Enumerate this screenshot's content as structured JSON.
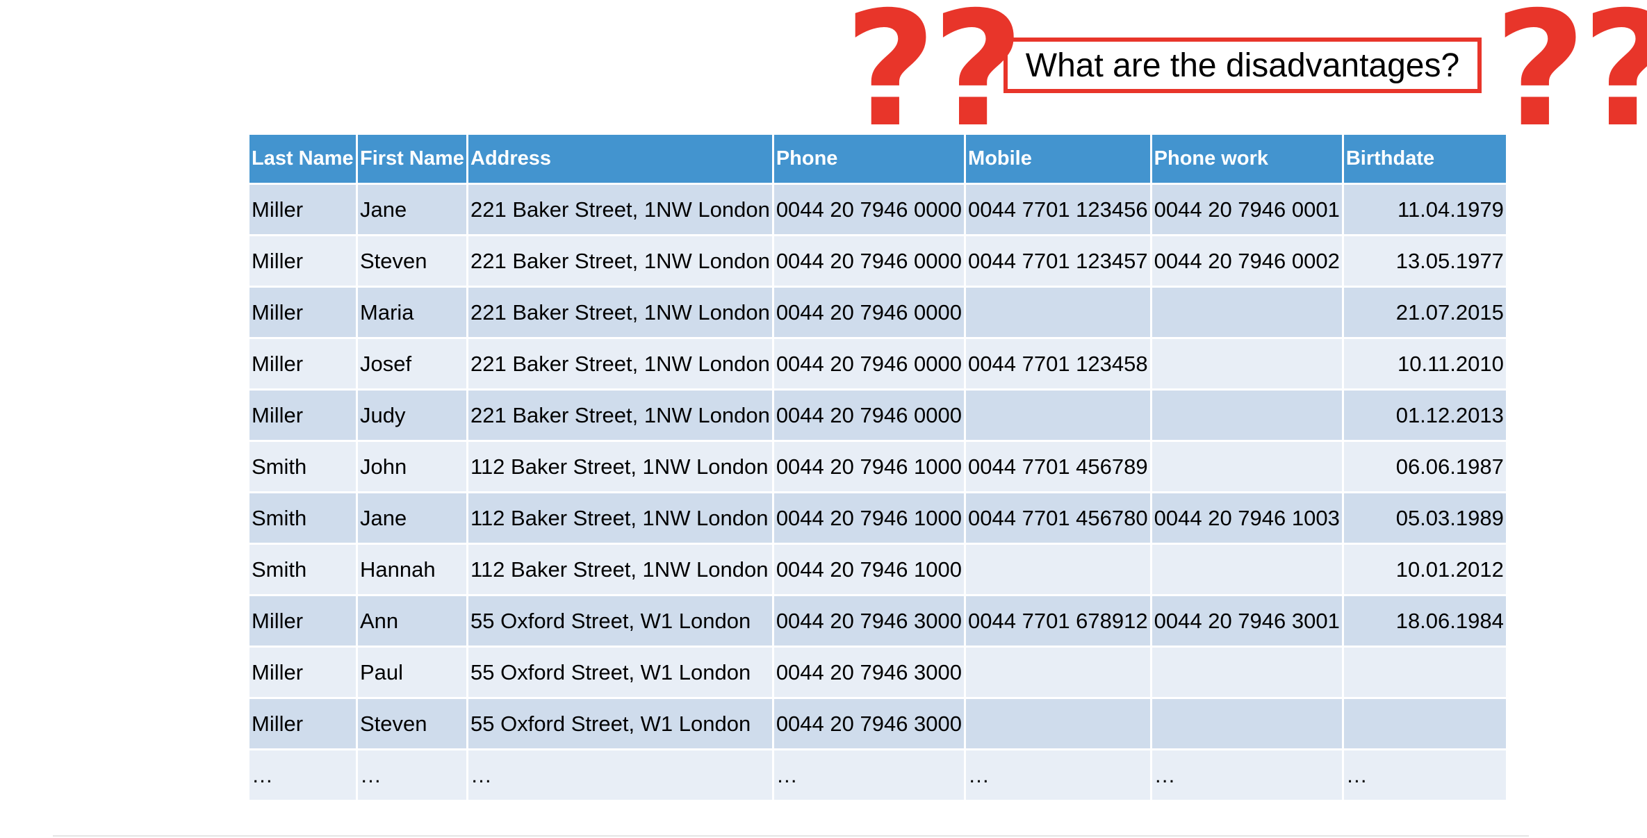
{
  "callout": {
    "text": "What are the disadvantages?"
  },
  "question_marks": {
    "left": "??",
    "right": "??"
  },
  "table": {
    "headers": [
      "Last Name",
      "First Name",
      "Address",
      "Phone",
      "Mobile",
      "Phone work",
      "Birthdate"
    ],
    "rows": [
      [
        "Miller",
        "Jane",
        "221 Baker Street, 1NW London",
        "0044 20  7946 0000",
        "0044 7701 123456",
        "0044 20  7946 0001",
        "11.04.1979"
      ],
      [
        "Miller",
        "Steven",
        "221 Baker Street, 1NW London",
        "0044 20  7946 0000",
        "0044 7701 123457",
        "0044 20  7946 0002",
        "13.05.1977"
      ],
      [
        "Miller",
        "Maria",
        "221 Baker Street, 1NW London",
        "0044 20  7946 0000",
        "",
        "",
        "21.07.2015"
      ],
      [
        "Miller",
        "Josef",
        "221 Baker Street, 1NW London",
        "0044 20  7946 0000",
        "0044 7701 123458",
        "",
        "10.11.2010"
      ],
      [
        "Miller",
        "Judy",
        "221 Baker Street, 1NW London",
        "0044 20  7946 0000",
        "",
        "",
        "01.12.2013"
      ],
      [
        "Smith",
        "John",
        "112 Baker Street, 1NW London",
        "0044 20  7946 1000",
        "0044 7701 456789",
        "",
        "06.06.1987"
      ],
      [
        "Smith",
        "Jane",
        "112 Baker Street, 1NW London",
        "0044 20  7946 1000",
        "0044 7701 456780",
        "0044 20  7946 1003",
        "05.03.1989"
      ],
      [
        "Smith",
        "Hannah",
        "112 Baker Street, 1NW London",
        "0044 20  7946 1000",
        "",
        "",
        "10.01.2012"
      ],
      [
        "Miller",
        "Ann",
        "55 Oxford Street, W1 London",
        "0044 20  7946 3000",
        "0044 7701 678912",
        "0044 20  7946 3001",
        "18.06.1984"
      ],
      [
        "Miller",
        "Paul",
        "55 Oxford Street, W1 London",
        "0044 20  7946 3000",
        "",
        "",
        ""
      ],
      [
        "Miller",
        "Steven",
        "55 Oxford Street, W1 London",
        "0044 20  7946 3000",
        "",
        "",
        ""
      ],
      [
        "…",
        "…",
        "…",
        "…",
        "…",
        "…",
        "…"
      ]
    ]
  },
  "colors": {
    "header_bg": "#4394cf",
    "row_dark": "#cfdcec",
    "row_light": "#e8eef6",
    "accent_red": "#e8352a"
  }
}
